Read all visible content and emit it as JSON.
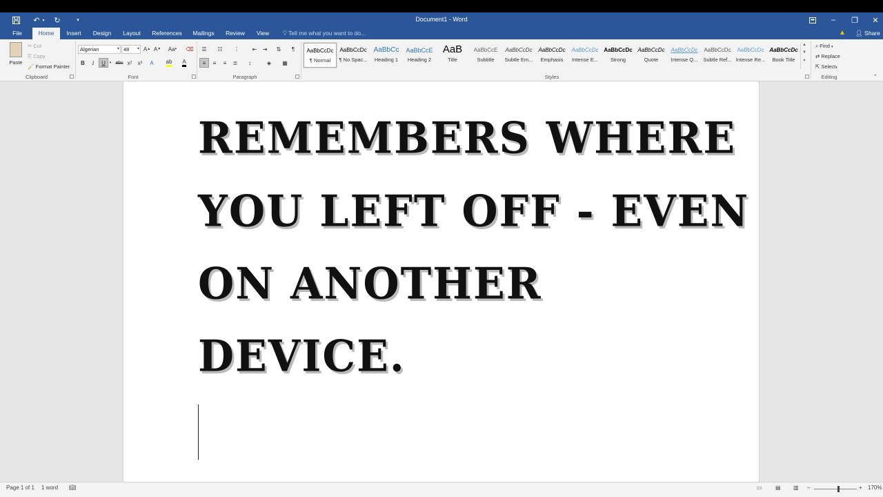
{
  "window": {
    "title": "Document1 - Word"
  },
  "tabs": [
    {
      "label": "File"
    },
    {
      "label": "Home"
    },
    {
      "label": "Insert"
    },
    {
      "label": "Design"
    },
    {
      "label": "Layout"
    },
    {
      "label": "References"
    },
    {
      "label": "Mailings"
    },
    {
      "label": "Review"
    },
    {
      "label": "View"
    }
  ],
  "tell_me": "Tell me what you want to do...",
  "share": "Share",
  "clipboard": {
    "paste": "Paste",
    "cut": "Cut",
    "copy": "Copy",
    "format_painter": "Format Painter",
    "group": "Clipboard"
  },
  "font": {
    "name": "Algerian",
    "size": "48",
    "group": "Font",
    "change_case": "Aa"
  },
  "paragraph": {
    "group": "Paragraph"
  },
  "styles": {
    "group": "Styles",
    "items": [
      {
        "sample": "AaBbCcDc",
        "label": "¶ Normal"
      },
      {
        "sample": "AaBbCcDc",
        "label": "¶ No Spac..."
      },
      {
        "sample": "AaBbCc",
        "label": "Heading 1"
      },
      {
        "sample": "AaBbCcE",
        "label": "Heading 2"
      },
      {
        "sample": "AaB",
        "label": "Title"
      },
      {
        "sample": "AaBbCcE",
        "label": "Subtitle"
      },
      {
        "sample": "AaBbCcDc",
        "label": "Subtle Em..."
      },
      {
        "sample": "AaBbCcDc",
        "label": "Emphasis"
      },
      {
        "sample": "AaBbCcDc",
        "label": "Intense E..."
      },
      {
        "sample": "AaBbCcDc",
        "label": "Strong"
      },
      {
        "sample": "AaBbCcDc",
        "label": "Quote"
      },
      {
        "sample": "AaBbCcDc",
        "label": "Intense Q..."
      },
      {
        "sample": "AaBbCcDc",
        "label": "Subtle Ref..."
      },
      {
        "sample": "AaBbCcDc",
        "label": "Intense Re..."
      },
      {
        "sample": "AaBbCcDc",
        "label": "Book Title"
      }
    ]
  },
  "editing": {
    "find": "Find",
    "replace": "Replace",
    "select": "Select",
    "group": "Editing"
  },
  "document": {
    "lines": [
      "REMEMBERS WHERE",
      "YOU LEFT OFF - EVEN",
      "ON ANOTHER",
      "DEVICE."
    ]
  },
  "status": {
    "page": "Page 1 of 1",
    "words": "1 word",
    "zoom": "170%"
  }
}
